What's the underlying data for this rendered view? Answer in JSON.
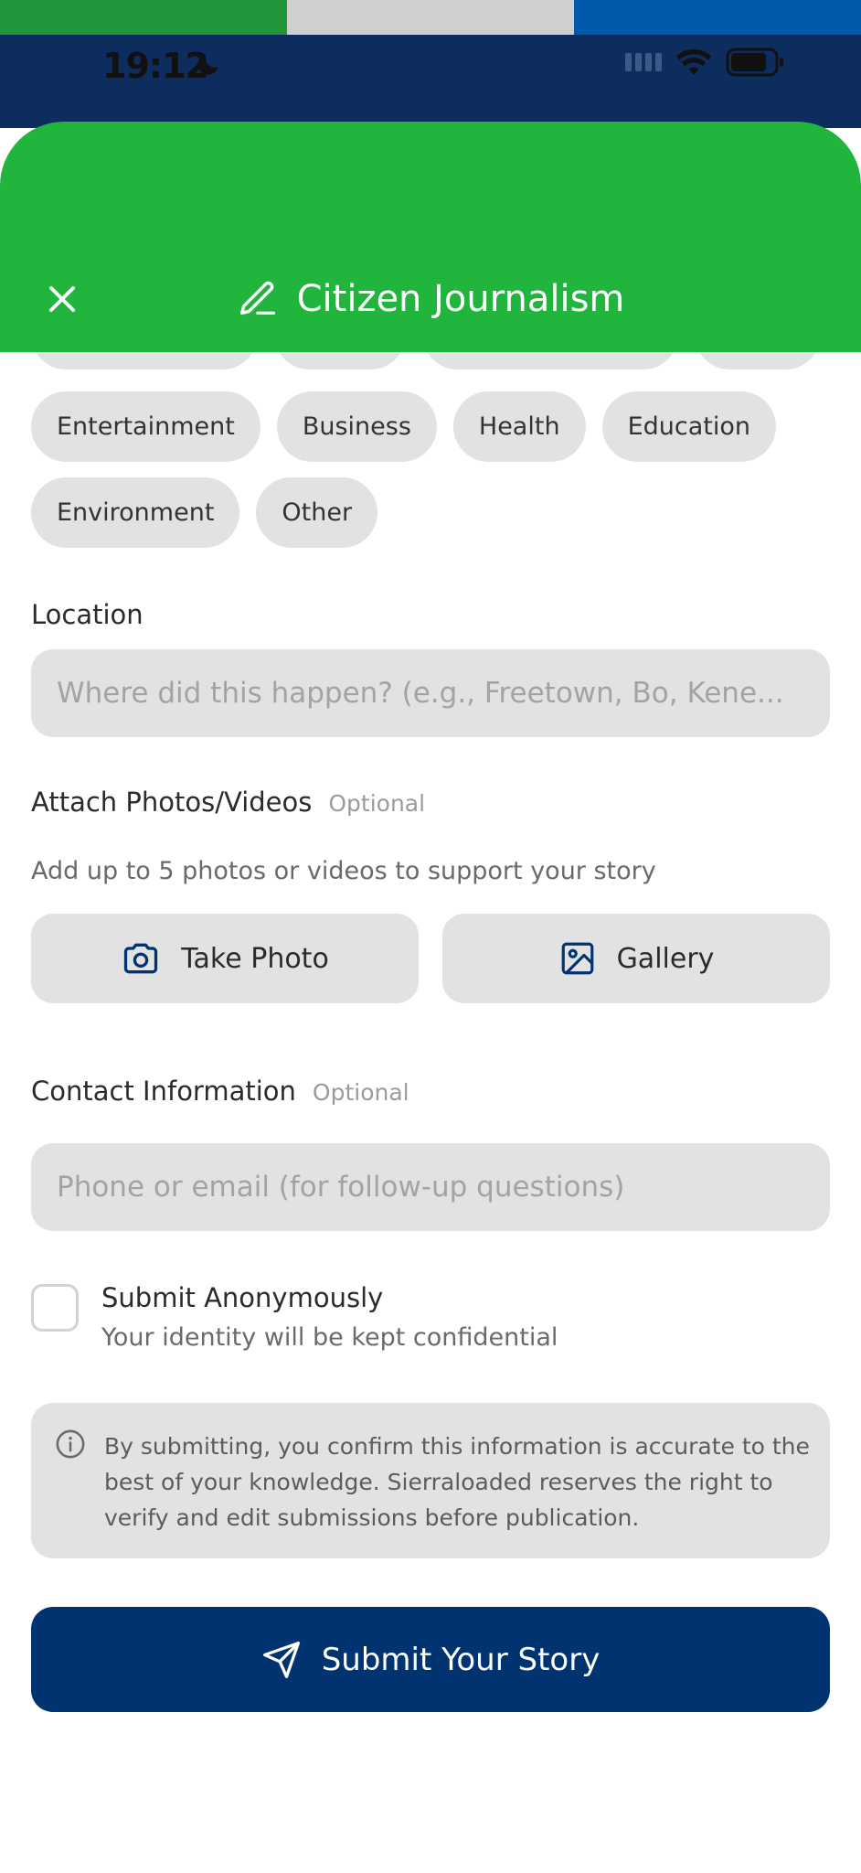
{
  "theme": {
    "flag_green": "#23963b",
    "flag_white": "#cfcfcf",
    "flag_blue": "#005aab",
    "header_green": "#21b53d",
    "primary_blue": "#003370"
  },
  "status_bar": {
    "time": "19:12",
    "icons": [
      "moon-icon",
      "signal-icon",
      "wifi-icon",
      "battery-icon"
    ]
  },
  "header": {
    "title": "Citizen Journalism",
    "close_icon": "close-icon",
    "title_icon": "pen-icon"
  },
  "categories": {
    "row1": [
      "Entertainment",
      "Business",
      "Health",
      "Education"
    ],
    "row2": [
      "Environment",
      "Other"
    ]
  },
  "location": {
    "label": "Location",
    "placeholder": "Where did this happen? (e.g., Freetown, Bo, Kene..."
  },
  "attachments": {
    "label": "Attach Photos/Videos",
    "optional": "Optional",
    "helper": "Add up to 5 photos or videos to support your story",
    "take_photo": "Take Photo",
    "gallery": "Gallery"
  },
  "contact": {
    "label": "Contact Information",
    "optional": "Optional",
    "placeholder": "Phone or email (for follow-up questions)"
  },
  "anonymous": {
    "title": "Submit Anonymously",
    "subtitle": "Your identity will be kept confidential",
    "checked": false
  },
  "notice": {
    "text": "By submitting, you confirm this information is accurate to the best of your knowledge. Sierraloaded reserves the right to verify and edit submissions before publication."
  },
  "submit": {
    "label": "Submit Your Story"
  }
}
